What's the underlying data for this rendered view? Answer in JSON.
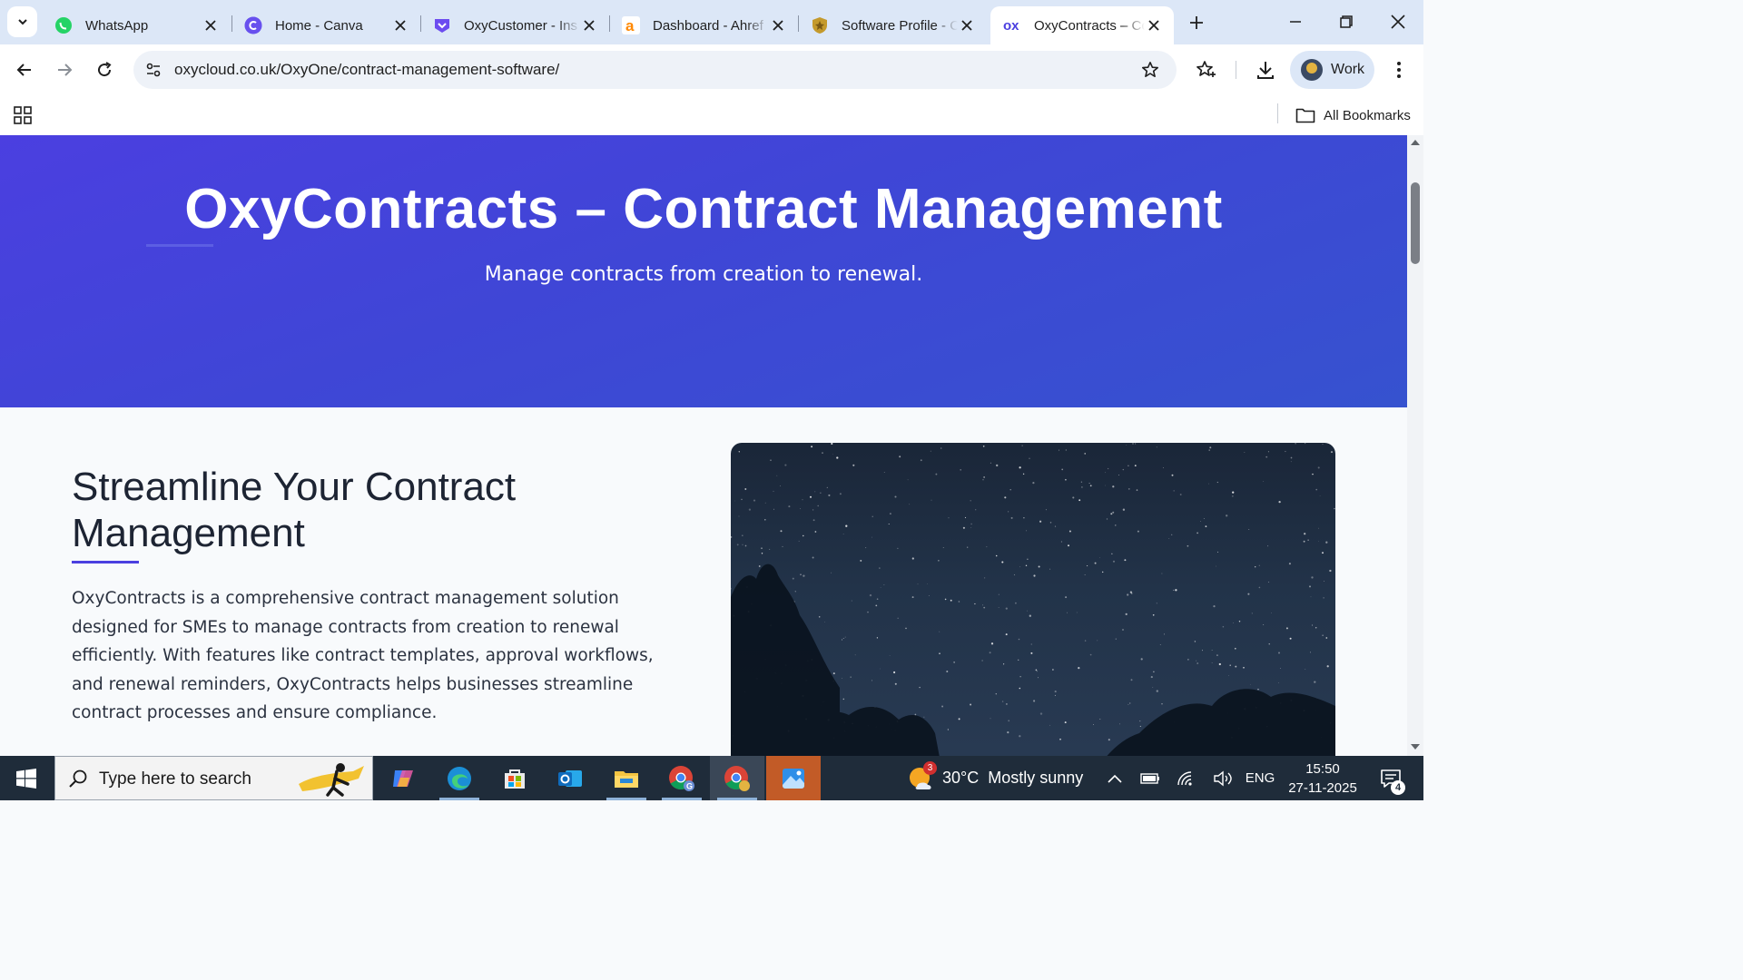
{
  "browser": {
    "tabs": [
      {
        "title": "WhatsApp",
        "icon": "whatsapp-icon",
        "color": "#25d366"
      },
      {
        "title": "Home - Canva",
        "icon": "canva-icon",
        "color": "#7d2ae8"
      },
      {
        "title": "OxyCustomer - Ins",
        "icon": "oxycustomer-icon",
        "color": "#6c4cf0"
      },
      {
        "title": "Dashboard - Ahref",
        "icon": "ahrefs-icon",
        "color": "#ff8800"
      },
      {
        "title": "Software Profile - C",
        "icon": "shield-badge-icon",
        "color": "#c49a2c"
      },
      {
        "title": "OxyContracts – Co",
        "icon": "oxy-logo-icon",
        "color": "#4b3fe0",
        "active": true
      }
    ],
    "url": "oxycloud.co.uk/OxyOne/contract-management-software/",
    "profile_label": "Work",
    "all_bookmarks_label": "All Bookmarks"
  },
  "page": {
    "hero_title": "OxyContracts – Contract Management",
    "hero_subtitle": "Manage contracts from creation to renewal.",
    "section_heading": "Streamline Your Contract Management",
    "section_body": "OxyContracts is a comprehensive contract management solution designed for SMEs to manage contracts from creation to renewal efficiently. With features like contract templates, approval workflows, and renewal reminders, OxyContracts helps businesses streamline contract processes and ensure compliance.",
    "accent_color": "#4b3fe0"
  },
  "taskbar": {
    "search_placeholder": "Type here to search",
    "apps": [
      "copilot-icon",
      "edge-icon",
      "store-icon",
      "outlook-icon",
      "file-explorer-icon",
      "chrome-profile-icon",
      "chrome-icon",
      "photos-icon"
    ],
    "weather_temp": "30°C",
    "weather_desc": "Mostly sunny",
    "weather_badge": "3",
    "language": "ENG",
    "time": "15:50",
    "date": "27-11-2025",
    "notification_count": "4"
  }
}
